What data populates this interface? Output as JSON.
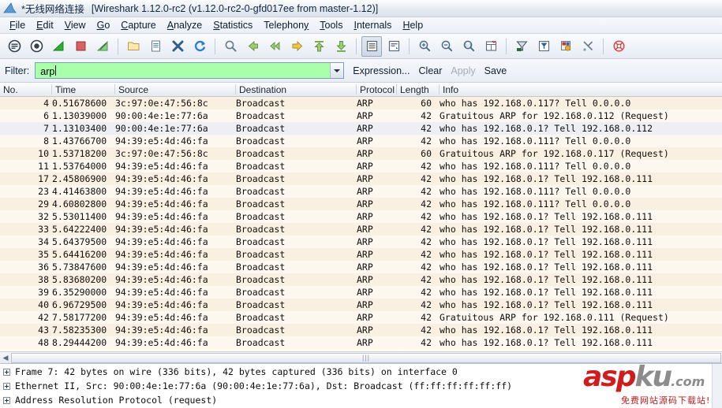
{
  "window": {
    "icon": "wireshark-shark-fin-icon",
    "capture_name": "*无线网络连接",
    "app_title": "[Wireshark 1.12.0-rc2  (v1.12.0-rc2-0-gfd017ee from master-1.12)]"
  },
  "menu": {
    "items": [
      {
        "label": "File",
        "mnemonic": "F"
      },
      {
        "label": "Edit",
        "mnemonic": "E"
      },
      {
        "label": "View",
        "mnemonic": "V"
      },
      {
        "label": "Go",
        "mnemonic": "G"
      },
      {
        "label": "Capture",
        "mnemonic": "C"
      },
      {
        "label": "Analyze",
        "mnemonic": "A"
      },
      {
        "label": "Statistics",
        "mnemonic": "S"
      },
      {
        "label": "Telephony",
        "mnemonic": "y"
      },
      {
        "label": "Tools",
        "mnemonic": "T"
      },
      {
        "label": "Internals",
        "mnemonic": "I"
      },
      {
        "label": "Help",
        "mnemonic": "H"
      }
    ]
  },
  "toolbar": {
    "buttons": [
      "interfaces-icon",
      "capture-options-icon",
      "start-capture-icon",
      "stop-capture-icon",
      "restart-capture-icon",
      "sep",
      "open-file-icon",
      "save-file-icon",
      "close-file-icon",
      "reload-icon",
      "sep",
      "find-packet-icon",
      "go-back-icon",
      "go-forward-icon",
      "go-to-packet-icon",
      "go-to-first-packet-icon",
      "go-to-last-packet-icon",
      "sep",
      "colorize-packet-list-icon",
      "auto-scroll-live-capture-icon",
      "sep",
      "zoom-in-icon",
      "zoom-out-icon",
      "zoom-reset-icon",
      "resize-columns-icon",
      "sep",
      "capture-filters-icon",
      "display-filters-icon",
      "coloring-rules-icon",
      "preferences-icon",
      "sep",
      "help-icon"
    ]
  },
  "filter": {
    "label": "Filter:",
    "value": "arp",
    "placeholder": "",
    "valid_bg": "#aaffaa",
    "dropdown_icon": "chevron-down-icon",
    "expression_label": "Expression...",
    "clear_label": "Clear",
    "apply_label": "Apply",
    "apply_enabled": false,
    "save_label": "Save"
  },
  "packet_list": {
    "columns": [
      "No.",
      "Time",
      "Source",
      "Destination",
      "Protocol",
      "Length",
      "Info"
    ],
    "selected_no": "7",
    "rows": [
      {
        "no": "4",
        "time": "0.51678600",
        "src": "3c:97:0e:47:56:8c",
        "dst": "Broadcast",
        "proto": "ARP",
        "len": "60",
        "info": "who has 192.168.0.117?  Tell 0.0.0.0"
      },
      {
        "no": "6",
        "time": "1.13039000",
        "src": "90:00:4e:1e:77:6a",
        "dst": "Broadcast",
        "proto": "ARP",
        "len": "42",
        "info": "Gratuitous ARP for 192.168.0.112 (Request)"
      },
      {
        "no": "7",
        "time": "1.13103400",
        "src": "90:00:4e:1e:77:6a",
        "dst": "Broadcast",
        "proto": "ARP",
        "len": "42",
        "info": "who has 192.168.0.1?  Tell 192.168.0.112"
      },
      {
        "no": "8",
        "time": "1.43766700",
        "src": "94:39:e5:4d:46:fa",
        "dst": "Broadcast",
        "proto": "ARP",
        "len": "42",
        "info": "who has 192.168.0.111?  Tell 0.0.0.0"
      },
      {
        "no": "10",
        "time": "1.53718200",
        "src": "3c:97:0e:47:56:8c",
        "dst": "Broadcast",
        "proto": "ARP",
        "len": "60",
        "info": "Gratuitous ARP for 192.168.0.117 (Request)"
      },
      {
        "no": "11",
        "time": "1.53764000",
        "src": "94:39:e5:4d:46:fa",
        "dst": "Broadcast",
        "proto": "ARP",
        "len": "42",
        "info": "who has 192.168.0.111?  Tell 0.0.0.0"
      },
      {
        "no": "17",
        "time": "2.45806900",
        "src": "94:39:e5:4d:46:fa",
        "dst": "Broadcast",
        "proto": "ARP",
        "len": "42",
        "info": "who has 192.168.0.1?  Tell 192.168.0.111"
      },
      {
        "no": "23",
        "time": "4.41463800",
        "src": "94:39:e5:4d:46:fa",
        "dst": "Broadcast",
        "proto": "ARP",
        "len": "42",
        "info": "who has 192.168.0.111?  Tell 0.0.0.0"
      },
      {
        "no": "29",
        "time": "4.60802800",
        "src": "94:39:e5:4d:46:fa",
        "dst": "Broadcast",
        "proto": "ARP",
        "len": "42",
        "info": "who has 192.168.0.111?  Tell 0.0.0.0"
      },
      {
        "no": "32",
        "time": "5.53011400",
        "src": "94:39:e5:4d:46:fa",
        "dst": "Broadcast",
        "proto": "ARP",
        "len": "42",
        "info": "who has 192.168.0.1?  Tell 192.168.0.111"
      },
      {
        "no": "33",
        "time": "5.64222400",
        "src": "94:39:e5:4d:46:fa",
        "dst": "Broadcast",
        "proto": "ARP",
        "len": "42",
        "info": "who has 192.168.0.1?  Tell 192.168.0.111"
      },
      {
        "no": "34",
        "time": "5.64379500",
        "src": "94:39:e5:4d:46:fa",
        "dst": "Broadcast",
        "proto": "ARP",
        "len": "42",
        "info": "who has 192.168.0.1?  Tell 192.168.0.111"
      },
      {
        "no": "35",
        "time": "5.64416200",
        "src": "94:39:e5:4d:46:fa",
        "dst": "Broadcast",
        "proto": "ARP",
        "len": "42",
        "info": "who has 192.168.0.1?  Tell 192.168.0.111"
      },
      {
        "no": "36",
        "time": "5.73847600",
        "src": "94:39:e5:4d:46:fa",
        "dst": "Broadcast",
        "proto": "ARP",
        "len": "42",
        "info": "who has 192.168.0.1?  Tell 192.168.0.111"
      },
      {
        "no": "38",
        "time": "5.83680200",
        "src": "94:39:e5:4d:46:fa",
        "dst": "Broadcast",
        "proto": "ARP",
        "len": "42",
        "info": "who has 192.168.0.1?  Tell 192.168.0.111"
      },
      {
        "no": "39",
        "time": "6.35290000",
        "src": "94:39:e5:4d:46:fa",
        "dst": "Broadcast",
        "proto": "ARP",
        "len": "42",
        "info": "who has 192.168.0.1?  Tell 192.168.0.111"
      },
      {
        "no": "40",
        "time": "6.96729500",
        "src": "94:39:e5:4d:46:fa",
        "dst": "Broadcast",
        "proto": "ARP",
        "len": "42",
        "info": "who has 192.168.0.1?  Tell 192.168.0.111"
      },
      {
        "no": "42",
        "time": "7.58177200",
        "src": "94:39:e5:4d:46:fa",
        "dst": "Broadcast",
        "proto": "ARP",
        "len": "42",
        "info": "Gratuitous ARP for 192.168.0.111 (Request)"
      },
      {
        "no": "43",
        "time": "7.58235300",
        "src": "94:39:e5:4d:46:fa",
        "dst": "Broadcast",
        "proto": "ARP",
        "len": "42",
        "info": "who has 192.168.0.1?  Tell 192.168.0.111"
      },
      {
        "no": "48",
        "time": "8.29444200",
        "src": "94:39:e5:4d:46:fa",
        "dst": "Broadcast",
        "proto": "ARP",
        "len": "42",
        "info": "who has 192.168.0.1?  Tell 192.168.0.111"
      }
    ]
  },
  "detail_pane": {
    "rows": [
      "Frame 7: 42 bytes on wire (336 bits), 42 bytes captured (336 bits) on interface 0",
      "Ethernet II, Src: 90:00:4e:1e:77:6a (90:00:4e:1e:77:6a), Dst: Broadcast (ff:ff:ff:ff:ff:ff)",
      "Address Resolution Protocol (request)"
    ]
  },
  "watermark": {
    "part_red": "asp",
    "part_gray": "ku",
    "part_com": ".com",
    "subtitle": "免费网站源码下载站!"
  },
  "colors": {
    "filter_valid": "#aaffaa",
    "row_odd": "#faf0e1",
    "row_even": "#fdf8ef",
    "row_selected": "#edeff4",
    "watermark_red": "#cf1d1d",
    "watermark_gray": "#8c8c8c"
  }
}
